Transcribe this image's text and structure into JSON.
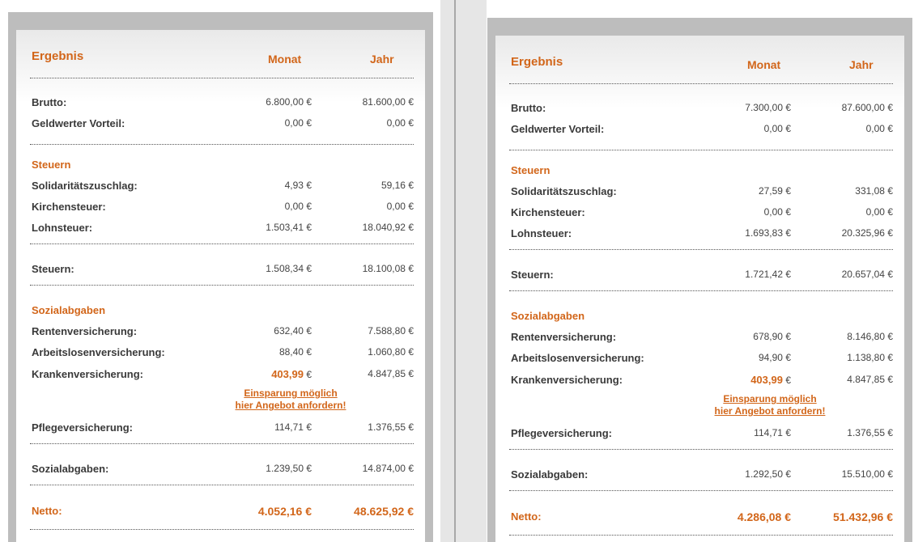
{
  "panels": [
    {
      "title": "Ergebnis",
      "col_month": "Monat",
      "col_year": "Jahr",
      "brutto": {
        "label": "Brutto:",
        "month": "6.800,00 €",
        "year": "81.600,00 €"
      },
      "vorteil": {
        "label": "Geldwerter Vorteil:",
        "month": "0,00 €",
        "year": "0,00 €"
      },
      "steuern_section": "Steuern",
      "soli": {
        "label": "Solidaritätszuschlag:",
        "month": "4,93 €",
        "year": "59,16 €"
      },
      "kirche": {
        "label": "Kirchensteuer:",
        "month": "0,00 €",
        "year": "0,00 €"
      },
      "lohn": {
        "label": "Lohnsteuer:",
        "month": "1.503,41 €",
        "year": "18.040,92 €"
      },
      "steuern_total": {
        "label": "Steuern:",
        "month": "1.508,34 €",
        "year": "18.100,08 €"
      },
      "sozial_section": "Sozialabgaben",
      "rente": {
        "label": "Rentenversicherung:",
        "month": "632,40 €",
        "year": "7.588,80 €"
      },
      "arbeit": {
        "label": "Arbeitslosenversicherung:",
        "month": "88,40 €",
        "year": "1.060,80 €"
      },
      "kranken": {
        "label": "Krankenversicherung:",
        "month_value": "403,99",
        "month_unit": "€",
        "year": "4.847,85 €"
      },
      "link_line1": "Einsparung möglich",
      "link_line2": "hier Angebot anfordern!",
      "pflege": {
        "label": "Pflegeversicherung:",
        "month": "114,71 €",
        "year": "1.376,55 €"
      },
      "sozial_total": {
        "label": "Sozialabgaben:",
        "month": "1.239,50 €",
        "year": "14.874,00 €"
      },
      "netto": {
        "label": "Netto:",
        "month": "4.052,16 €",
        "year": "48.625,92 €"
      }
    },
    {
      "title": "Ergebnis",
      "col_month": "Monat",
      "col_year": "Jahr",
      "brutto": {
        "label": "Brutto:",
        "month": "7.300,00 €",
        "year": "87.600,00 €"
      },
      "vorteil": {
        "label": "Geldwerter Vorteil:",
        "month": "0,00 €",
        "year": "0,00 €"
      },
      "steuern_section": "Steuern",
      "soli": {
        "label": "Solidaritätszuschlag:",
        "month": "27,59 €",
        "year": "331,08 €"
      },
      "kirche": {
        "label": "Kirchensteuer:",
        "month": "0,00 €",
        "year": "0,00 €"
      },
      "lohn": {
        "label": "Lohnsteuer:",
        "month": "1.693,83 €",
        "year": "20.325,96 €"
      },
      "steuern_total": {
        "label": "Steuern:",
        "month": "1.721,42 €",
        "year": "20.657,04 €"
      },
      "sozial_section": "Sozialabgaben",
      "rente": {
        "label": "Rentenversicherung:",
        "month": "678,90 €",
        "year": "8.146,80 €"
      },
      "arbeit": {
        "label": "Arbeitslosenversicherung:",
        "month": "94,90 €",
        "year": "1.138,80 €"
      },
      "kranken": {
        "label": "Krankenversicherung:",
        "month_value": "403,99",
        "month_unit": "€",
        "year": "4.847,85 €"
      },
      "link_line1": "Einsparung möglich",
      "link_line2": "hier Angebot anfordern!",
      "pflege": {
        "label": "Pflegeversicherung:",
        "month": "114,71 €",
        "year": "1.376,55 €"
      },
      "sozial_total": {
        "label": "Sozialabgaben:",
        "month": "1.292,50 €",
        "year": "15.510,00 €"
      },
      "netto": {
        "label": "Netto:",
        "month": "4.286,08 €",
        "year": "51.432,96 €"
      }
    }
  ]
}
